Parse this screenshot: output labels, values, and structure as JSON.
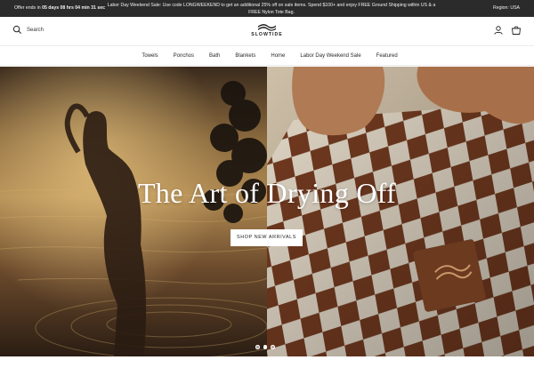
{
  "announcement": {
    "timer_prefix": "Offer ends in",
    "timer_value": "05 days 08 hrs 04 min 31 sec",
    "promo": "Labor Day Weekend Sale: Use code LONGWEEKEND to get an additional 25% off on sale items. Spend $100+ and enjoy FREE Ground Shipping within US & a FREE Nylon Tote Bag.",
    "region": "Region: USA"
  },
  "header": {
    "search_label": "Search",
    "logo_text": "SLOWTIDE",
    "icons": [
      "search-icon",
      "account-icon",
      "cart-icon"
    ]
  },
  "nav": {
    "items": [
      "Towels",
      "Ponchos",
      "Bath",
      "Blankets",
      "Home",
      "Labor Day Weekend Sale",
      "Featured"
    ]
  },
  "hero": {
    "title": "The Art of Drying Off",
    "button_label": "SHOP NEW ARRIVALS",
    "slides": 3,
    "active_slide": 2
  },
  "colors": {
    "announcement_bg": "#2b2b2b",
    "button_bg": "#ffffff",
    "checker_brown": "#7a3e22",
    "checker_cream": "#efe4d2"
  }
}
